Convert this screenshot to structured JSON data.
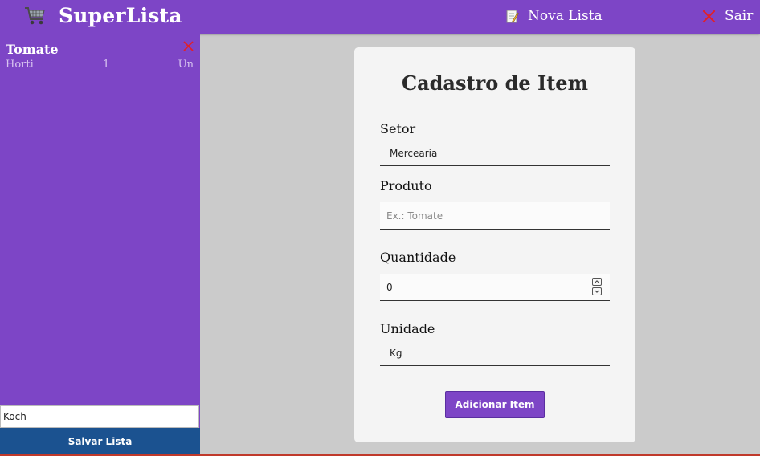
{
  "header": {
    "brand": "SuperLista",
    "new_list_label": "Nova Lista",
    "exit_label": "Sair",
    "icons": {
      "cart": "shopping-cart-icon",
      "new_list": "memo-icon",
      "exit": "close-x-icon"
    }
  },
  "sidebar": {
    "items": [
      {
        "name": "Tomate",
        "sector": "Horti",
        "quantity": "1",
        "unit": "Un"
      }
    ],
    "list_name_value": "Koch",
    "save_label": "Salvar Lista"
  },
  "form": {
    "title": "Cadastro de Item",
    "sector_label": "Setor",
    "sector_value": "Mercearia",
    "product_label": "Produto",
    "product_placeholder": "Ex.: Tomate",
    "quantity_label": "Quantidade",
    "quantity_value": "0",
    "unit_label": "Unidade",
    "unit_value": "Kg",
    "submit_label": "Adicionar Item"
  },
  "colors": {
    "brand_purple": "#7d45c6",
    "save_blue": "#1b5290",
    "background": "#cbcbcb",
    "remove_red": "#e0202a"
  }
}
